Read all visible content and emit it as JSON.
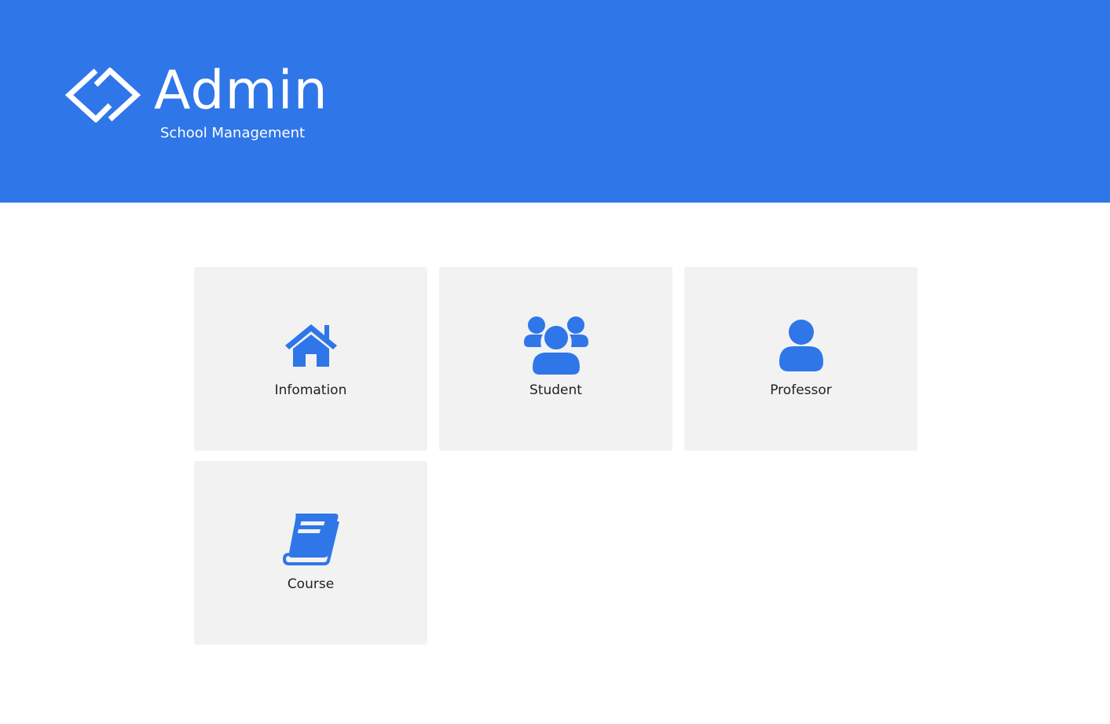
{
  "header": {
    "title": "Admin",
    "subtitle": "School Management",
    "logo_icon": "code-bracket-logo-icon",
    "background_color": "#2f76e8"
  },
  "tiles": [
    {
      "label": "Infomation",
      "icon": "home-icon"
    },
    {
      "label": "Student",
      "icon": "users-group-icon"
    },
    {
      "label": "Professor",
      "icon": "user-icon"
    },
    {
      "label": "Course",
      "icon": "book-icon"
    }
  ],
  "colors": {
    "accent": "#2f76e8",
    "tile_background": "#f2f2f2",
    "label_text": "#222222"
  }
}
